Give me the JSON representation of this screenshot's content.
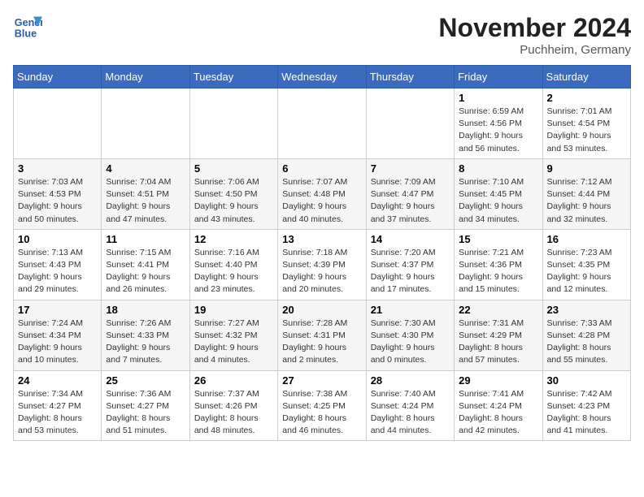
{
  "logo": {
    "line1": "General",
    "line2": "Blue"
  },
  "title": "November 2024",
  "location": "Puchheim, Germany",
  "weekdays": [
    "Sunday",
    "Monday",
    "Tuesday",
    "Wednesday",
    "Thursday",
    "Friday",
    "Saturday"
  ],
  "weeks": [
    [
      {
        "day": "",
        "info": ""
      },
      {
        "day": "",
        "info": ""
      },
      {
        "day": "",
        "info": ""
      },
      {
        "day": "",
        "info": ""
      },
      {
        "day": "",
        "info": ""
      },
      {
        "day": "1",
        "info": "Sunrise: 6:59 AM\nSunset: 4:56 PM\nDaylight: 9 hours and 56 minutes."
      },
      {
        "day": "2",
        "info": "Sunrise: 7:01 AM\nSunset: 4:54 PM\nDaylight: 9 hours and 53 minutes."
      }
    ],
    [
      {
        "day": "3",
        "info": "Sunrise: 7:03 AM\nSunset: 4:53 PM\nDaylight: 9 hours and 50 minutes."
      },
      {
        "day": "4",
        "info": "Sunrise: 7:04 AM\nSunset: 4:51 PM\nDaylight: 9 hours and 47 minutes."
      },
      {
        "day": "5",
        "info": "Sunrise: 7:06 AM\nSunset: 4:50 PM\nDaylight: 9 hours and 43 minutes."
      },
      {
        "day": "6",
        "info": "Sunrise: 7:07 AM\nSunset: 4:48 PM\nDaylight: 9 hours and 40 minutes."
      },
      {
        "day": "7",
        "info": "Sunrise: 7:09 AM\nSunset: 4:47 PM\nDaylight: 9 hours and 37 minutes."
      },
      {
        "day": "8",
        "info": "Sunrise: 7:10 AM\nSunset: 4:45 PM\nDaylight: 9 hours and 34 minutes."
      },
      {
        "day": "9",
        "info": "Sunrise: 7:12 AM\nSunset: 4:44 PM\nDaylight: 9 hours and 32 minutes."
      }
    ],
    [
      {
        "day": "10",
        "info": "Sunrise: 7:13 AM\nSunset: 4:43 PM\nDaylight: 9 hours and 29 minutes."
      },
      {
        "day": "11",
        "info": "Sunrise: 7:15 AM\nSunset: 4:41 PM\nDaylight: 9 hours and 26 minutes."
      },
      {
        "day": "12",
        "info": "Sunrise: 7:16 AM\nSunset: 4:40 PM\nDaylight: 9 hours and 23 minutes."
      },
      {
        "day": "13",
        "info": "Sunrise: 7:18 AM\nSunset: 4:39 PM\nDaylight: 9 hours and 20 minutes."
      },
      {
        "day": "14",
        "info": "Sunrise: 7:20 AM\nSunset: 4:37 PM\nDaylight: 9 hours and 17 minutes."
      },
      {
        "day": "15",
        "info": "Sunrise: 7:21 AM\nSunset: 4:36 PM\nDaylight: 9 hours and 15 minutes."
      },
      {
        "day": "16",
        "info": "Sunrise: 7:23 AM\nSunset: 4:35 PM\nDaylight: 9 hours and 12 minutes."
      }
    ],
    [
      {
        "day": "17",
        "info": "Sunrise: 7:24 AM\nSunset: 4:34 PM\nDaylight: 9 hours and 10 minutes."
      },
      {
        "day": "18",
        "info": "Sunrise: 7:26 AM\nSunset: 4:33 PM\nDaylight: 9 hours and 7 minutes."
      },
      {
        "day": "19",
        "info": "Sunrise: 7:27 AM\nSunset: 4:32 PM\nDaylight: 9 hours and 4 minutes."
      },
      {
        "day": "20",
        "info": "Sunrise: 7:28 AM\nSunset: 4:31 PM\nDaylight: 9 hours and 2 minutes."
      },
      {
        "day": "21",
        "info": "Sunrise: 7:30 AM\nSunset: 4:30 PM\nDaylight: 9 hours and 0 minutes."
      },
      {
        "day": "22",
        "info": "Sunrise: 7:31 AM\nSunset: 4:29 PM\nDaylight: 8 hours and 57 minutes."
      },
      {
        "day": "23",
        "info": "Sunrise: 7:33 AM\nSunset: 4:28 PM\nDaylight: 8 hours and 55 minutes."
      }
    ],
    [
      {
        "day": "24",
        "info": "Sunrise: 7:34 AM\nSunset: 4:27 PM\nDaylight: 8 hours and 53 minutes."
      },
      {
        "day": "25",
        "info": "Sunrise: 7:36 AM\nSunset: 4:27 PM\nDaylight: 8 hours and 51 minutes."
      },
      {
        "day": "26",
        "info": "Sunrise: 7:37 AM\nSunset: 4:26 PM\nDaylight: 8 hours and 48 minutes."
      },
      {
        "day": "27",
        "info": "Sunrise: 7:38 AM\nSunset: 4:25 PM\nDaylight: 8 hours and 46 minutes."
      },
      {
        "day": "28",
        "info": "Sunrise: 7:40 AM\nSunset: 4:24 PM\nDaylight: 8 hours and 44 minutes."
      },
      {
        "day": "29",
        "info": "Sunrise: 7:41 AM\nSunset: 4:24 PM\nDaylight: 8 hours and 42 minutes."
      },
      {
        "day": "30",
        "info": "Sunrise: 7:42 AM\nSunset: 4:23 PM\nDaylight: 8 hours and 41 minutes."
      }
    ]
  ]
}
